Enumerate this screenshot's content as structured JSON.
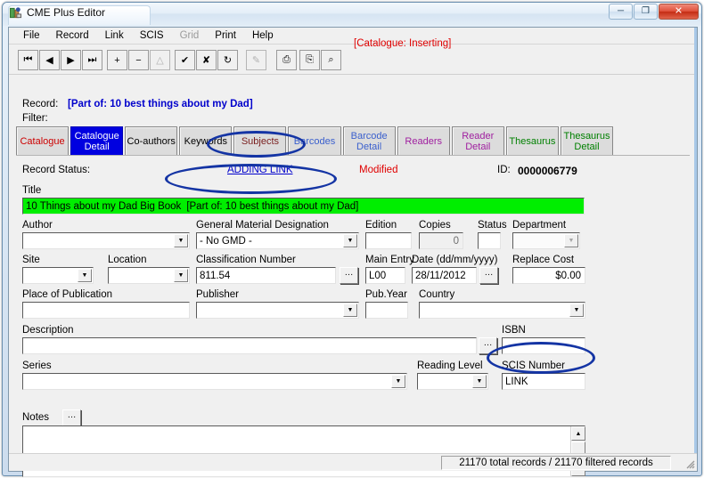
{
  "window": {
    "title": "CME Plus Editor",
    "icon": "app-icon",
    "buttons": {
      "minimize": "─",
      "maximize": "❐",
      "close": "✕"
    }
  },
  "menu": {
    "items": [
      {
        "label": "File",
        "enabled": true
      },
      {
        "label": "Record",
        "enabled": true
      },
      {
        "label": "Link",
        "enabled": true
      },
      {
        "label": "SCIS",
        "enabled": true
      },
      {
        "label": "Grid",
        "enabled": false
      },
      {
        "label": "Print",
        "enabled": true
      },
      {
        "label": "Help",
        "enabled": true
      }
    ]
  },
  "toolbar": {
    "buttons": [
      {
        "name": "first-record-button",
        "glyph": "⏮",
        "enabled": true
      },
      {
        "name": "previous-record-button",
        "glyph": "◀",
        "enabled": true
      },
      {
        "name": "next-record-button",
        "glyph": "▶",
        "enabled": true
      },
      {
        "name": "last-record-button",
        "glyph": "⏭",
        "enabled": true
      },
      {
        "name": "insert-record-button",
        "glyph": "+",
        "enabled": true
      },
      {
        "name": "delete-record-button",
        "glyph": "−",
        "enabled": true
      },
      {
        "name": "edit-record-button",
        "glyph": "△",
        "enabled": false
      },
      {
        "name": "post-edit-button",
        "glyph": "✔",
        "enabled": true
      },
      {
        "name": "cancel-edit-button",
        "glyph": "✘",
        "enabled": true
      },
      {
        "name": "refresh-button",
        "glyph": "↻",
        "enabled": true
      },
      {
        "name": "export-button",
        "glyph": "✎",
        "enabled": false
      },
      {
        "name": "print-button",
        "glyph": "⎙",
        "enabled": true
      },
      {
        "name": "print-report-button",
        "glyph": "⎘",
        "enabled": true
      },
      {
        "name": "print-preview-button",
        "glyph": "⌕",
        "enabled": true
      }
    ],
    "status_text": "[Catalogue: Inserting]"
  },
  "record_bar": {
    "record_label": "Record:",
    "record_value": "[Part of: 10 best things about my Dad]",
    "filter_label": "Filter:",
    "filter_value": ""
  },
  "tabs": [
    {
      "label_line1": "Catalogue",
      "label_line2": "",
      "color": "#cc0000",
      "selected": false,
      "name": "tab-catalogue"
    },
    {
      "label_line1": "Catalogue",
      "label_line2": "Detail",
      "color": "#ffffff",
      "selected": true,
      "name": "tab-catalogue-detail"
    },
    {
      "label_line1": "Co-authors",
      "label_line2": "",
      "color": "#000000",
      "selected": false,
      "name": "tab-co-authors"
    },
    {
      "label_line1": "Keywords",
      "label_line2": "",
      "color": "#000000",
      "selected": false,
      "name": "tab-keywords"
    },
    {
      "label_line1": "Subjects",
      "label_line2": "",
      "color": "#7a2020",
      "selected": false,
      "name": "tab-subjects"
    },
    {
      "label_line1": "Barcodes",
      "label_line2": "",
      "color": "#3a5fcd",
      "selected": false,
      "name": "tab-barcodes"
    },
    {
      "label_line1": "Barcode",
      "label_line2": "Detail",
      "color": "#3a5fcd",
      "selected": false,
      "name": "tab-barcode-detail"
    },
    {
      "label_line1": "Readers",
      "label_line2": "",
      "color": "#a020a0",
      "selected": false,
      "name": "tab-readers"
    },
    {
      "label_line1": "Reader",
      "label_line2": "Detail",
      "color": "#a020a0",
      "selected": false,
      "name": "tab-reader-detail"
    },
    {
      "label_line1": "Thesaurus",
      "label_line2": "",
      "color": "#008000",
      "selected": false,
      "name": "tab-thesaurus"
    },
    {
      "label_line1": "Thesaurus",
      "label_line2": "Detail",
      "color": "#008000",
      "selected": false,
      "name": "tab-thesaurus-detail"
    }
  ],
  "status_row": {
    "record_status_label": "Record Status:",
    "adding_link": "ADDING LINK",
    "modified": "Modified",
    "id_label": "ID:",
    "id_value": "0000006779"
  },
  "fields": {
    "title": {
      "label": "Title",
      "value_left": "10 Things about my Dad Big Book",
      "value_right": "[Part of: 10 best things about my Dad]"
    },
    "author": {
      "label": "Author",
      "value": ""
    },
    "gmd": {
      "label": "General Material Designation",
      "value": "- No GMD -"
    },
    "edition": {
      "label": "Edition",
      "value": ""
    },
    "copies": {
      "label": "Copies",
      "value": "0"
    },
    "status": {
      "label": "Status",
      "value": ""
    },
    "department": {
      "label": "Department",
      "value": ""
    },
    "site": {
      "label": "Site",
      "value": ""
    },
    "location": {
      "label": "Location",
      "value": ""
    },
    "classification_number": {
      "label": "Classification Number",
      "value": "811.54"
    },
    "main_entry": {
      "label": "Main Entry",
      "value": "L00"
    },
    "date": {
      "label": "Date (dd/mm/yyyy)",
      "value": "28/11/2012"
    },
    "replace_cost": {
      "label": "Replace Cost",
      "value": "$0.00"
    },
    "place_of_publication": {
      "label": "Place of Publication",
      "value": ""
    },
    "publisher": {
      "label": "Publisher",
      "value": ""
    },
    "pub_year": {
      "label": "Pub.Year",
      "value": ""
    },
    "country": {
      "label": "Country",
      "value": ""
    },
    "description": {
      "label": "Description",
      "value": ""
    },
    "isbn": {
      "label": "ISBN",
      "value": ""
    },
    "series": {
      "label": "Series",
      "value": ""
    },
    "reading_level": {
      "label": "Reading Level",
      "value": ""
    },
    "scis_number": {
      "label": "SCIS Number",
      "value": "LINK"
    },
    "notes": {
      "label": "Notes",
      "value": ""
    }
  },
  "ellipsis_label": "…",
  "statusbar": {
    "text": "21170 total records    /    21170 filtered records"
  },
  "annotations": {
    "oval_adding_link": "ADDING LINK",
    "oval_title_part_of": "[Part of: 10 best things about my Dad]",
    "oval_scis_link": "LINK"
  }
}
